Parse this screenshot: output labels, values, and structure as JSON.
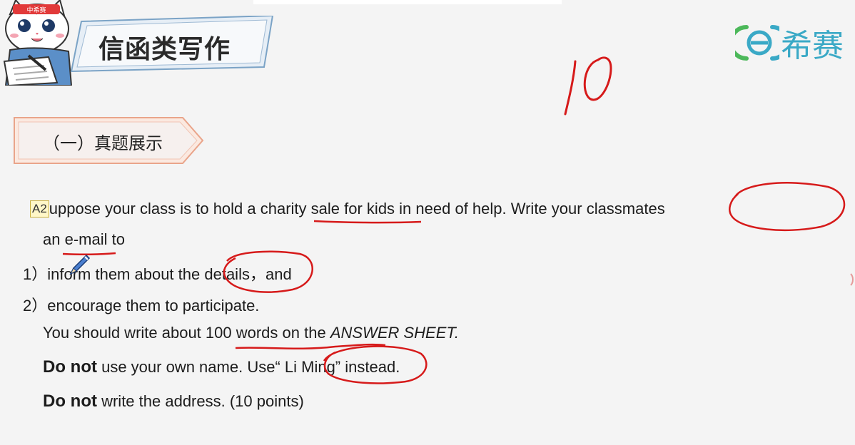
{
  "header": {
    "title": "信函类写作",
    "logo_text": "希赛",
    "mascot_headband": "中希赛"
  },
  "section": {
    "label": "（一）真题展示"
  },
  "handwriting": {
    "number": "10"
  },
  "content": {
    "badge": "A2",
    "lines": {
      "l1a": "uppose your class is to hold a ",
      "l1b": "charity sale",
      "l1c": " for kids in need of help. Write your ",
      "l1d": "classmates",
      "l2a": "an ",
      "l2b": "e-mail",
      "l2c": " to",
      "l3a": "1）inform them about t",
      "l3b": "he details",
      "l3c": "，and",
      "l4": "2）encourage them to participate.",
      "l5a": "You should write about 100 words on the ",
      "l5b": "ANSWER SHEET.",
      "l6a": "Do not",
      "l6b": " use your own name. Use",
      "l6c": "“ Li Ming”",
      "l6d": " instead.",
      "l7a": "Do not",
      "l7b": " write the address. (10 points)"
    }
  },
  "colors": {
    "ink": "#d61a1a",
    "brand": "#3aa9c6",
    "banner_border": "#7ba3c6",
    "section_border": "#e9a48a"
  }
}
